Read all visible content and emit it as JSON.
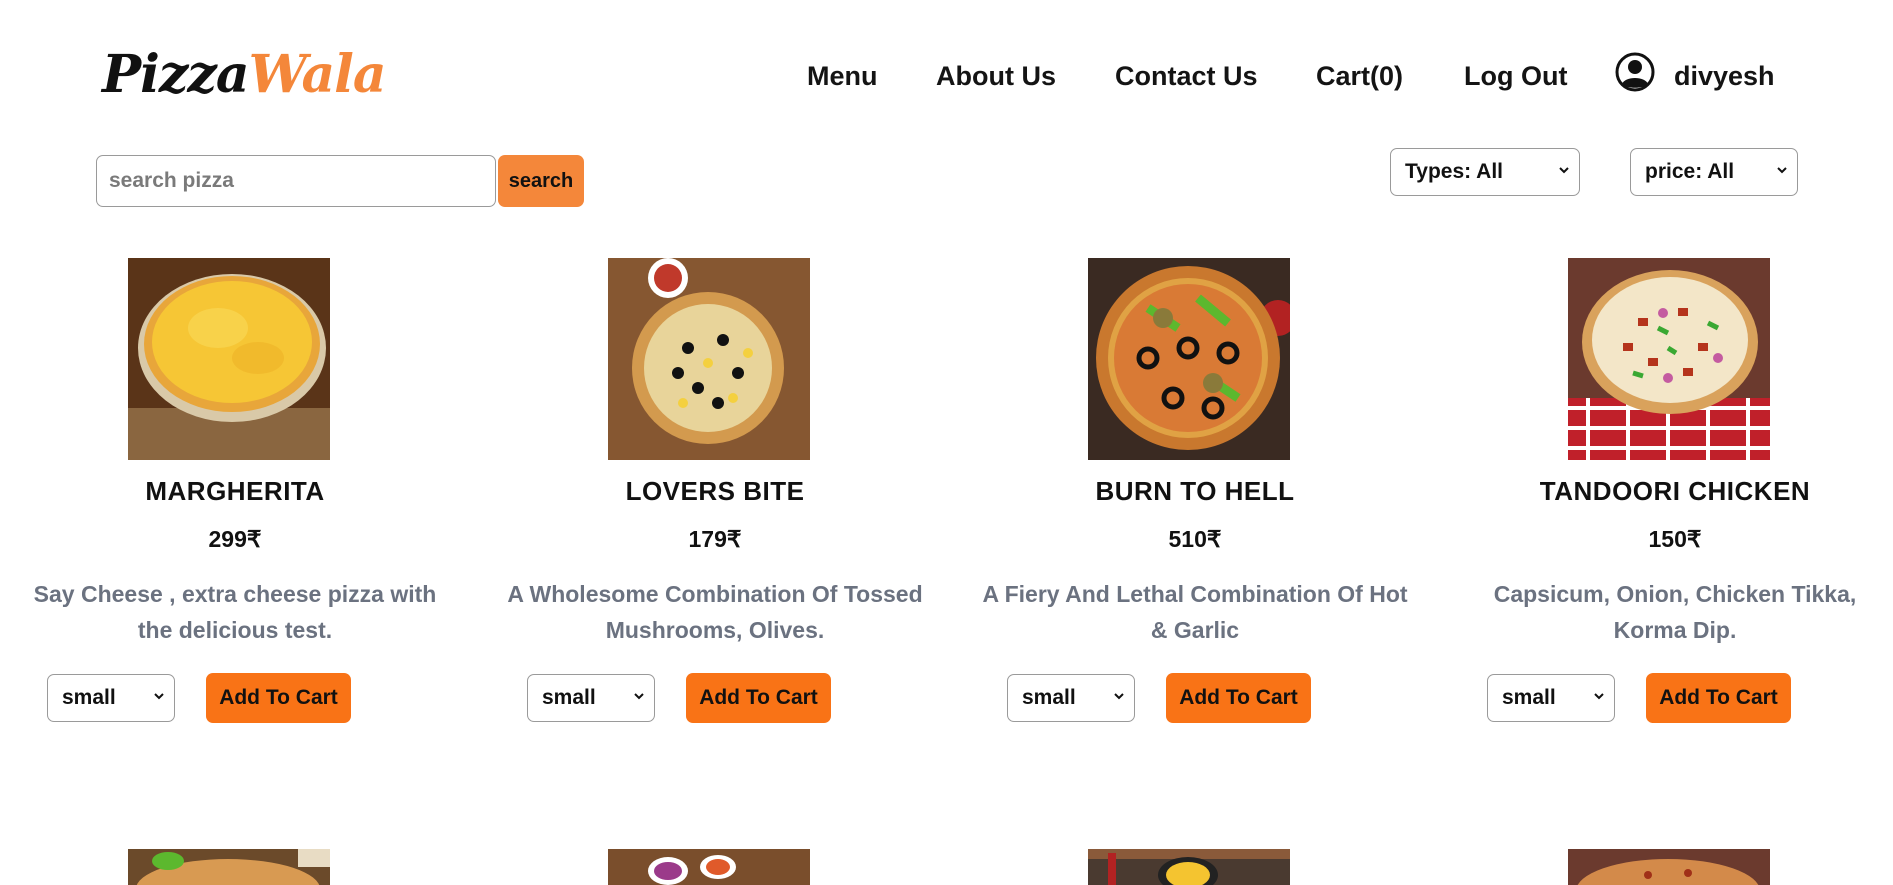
{
  "brand": {
    "part1": "Pizza",
    "part2": "Wala",
    "accent_color": "#f4873a"
  },
  "nav": {
    "items": [
      "Menu",
      "About Us",
      "Contact Us",
      "Cart(0)",
      "Log Out"
    ],
    "user_icon": "user-circle-icon",
    "username": "divyesh"
  },
  "search": {
    "placeholder": "search pizza",
    "button_label": "search"
  },
  "filters": {
    "type_selected": "Types: All",
    "price_selected": "price: All"
  },
  "pizzas": [
    {
      "name": "MARGHERITA",
      "price": "299₹",
      "description": "Say Cheese , extra cheese pizza with the delicious test.",
      "size": "small",
      "button": "Add To Cart"
    },
    {
      "name": "LOVERS BITE",
      "price": "179₹",
      "description": "A Wholesome Combination Of Tossed Mushrooms, Olives.",
      "size": "small",
      "button": "Add To Cart"
    },
    {
      "name": "BURN TO HELL",
      "price": "510₹",
      "description": "A Fiery And Lethal Combination Of Hot & Garlic",
      "size": "small",
      "button": "Add To Cart"
    },
    {
      "name": "TANDOORI CHICKEN",
      "price": "150₹",
      "description": "Capsicum, Onion, Chicken Tikka, Korma Dip.",
      "size": "small",
      "button": "Add To Cart"
    }
  ],
  "colors": {
    "button_orange": "#f97316",
    "description_gray": "#6b7280"
  }
}
